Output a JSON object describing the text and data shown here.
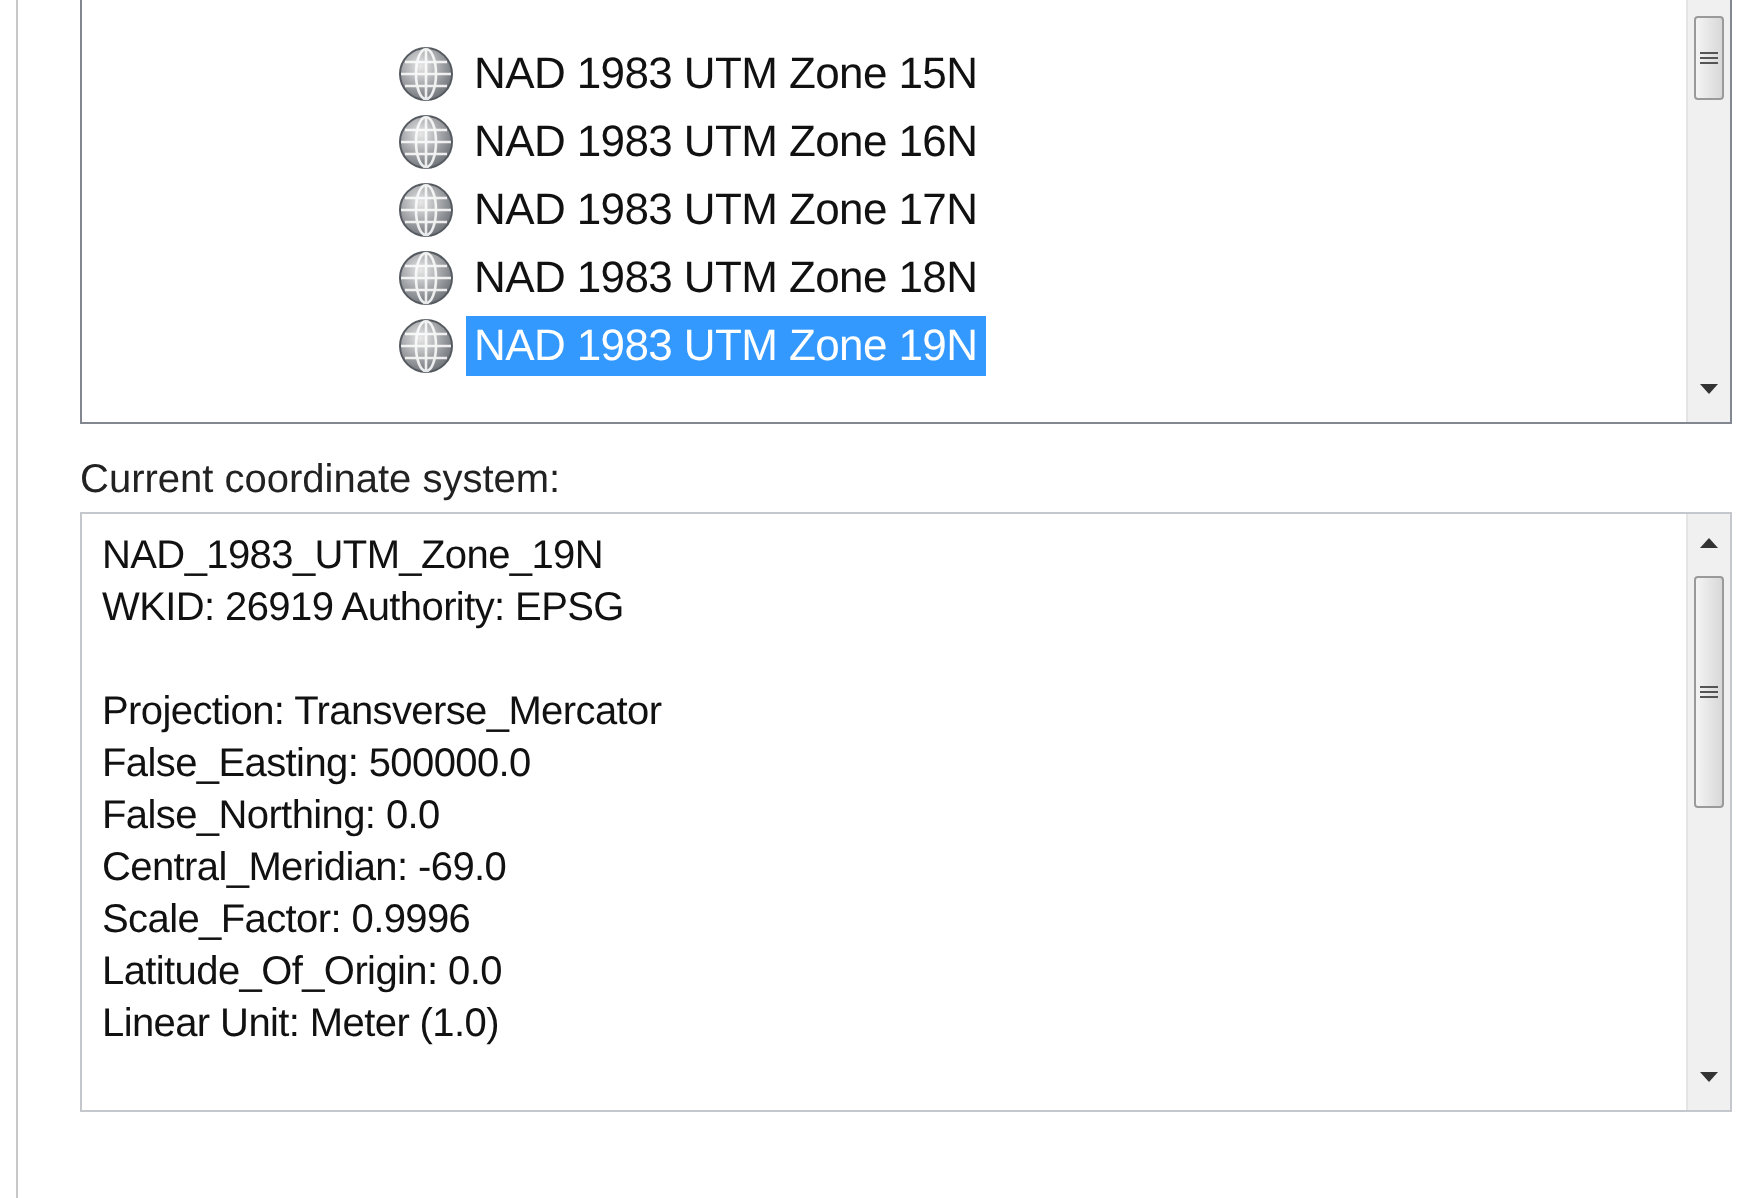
{
  "coordinate_list": {
    "items": [
      {
        "label": "NAD 1983 UTM Zone 15N",
        "selected": false
      },
      {
        "label": "NAD 1983 UTM Zone 16N",
        "selected": false
      },
      {
        "label": "NAD 1983 UTM Zone 17N",
        "selected": false
      },
      {
        "label": "NAD 1983 UTM Zone 18N",
        "selected": false
      },
      {
        "label": "NAD 1983 UTM Zone 19N",
        "selected": true
      }
    ]
  },
  "current_label": "Current coordinate system:",
  "details": [
    [
      "NAD_1983_UTM_Zone_19N",
      "WKID: 26919 Authority: EPSG"
    ],
    [
      "Projection: Transverse_Mercator",
      "False_Easting: 500000.0",
      "False_Northing: 0.0",
      "Central_Meridian: -69.0",
      "Scale_Factor: 0.9996",
      "Latitude_Of_Origin: 0.0",
      "Linear Unit: Meter (1.0)"
    ]
  ]
}
